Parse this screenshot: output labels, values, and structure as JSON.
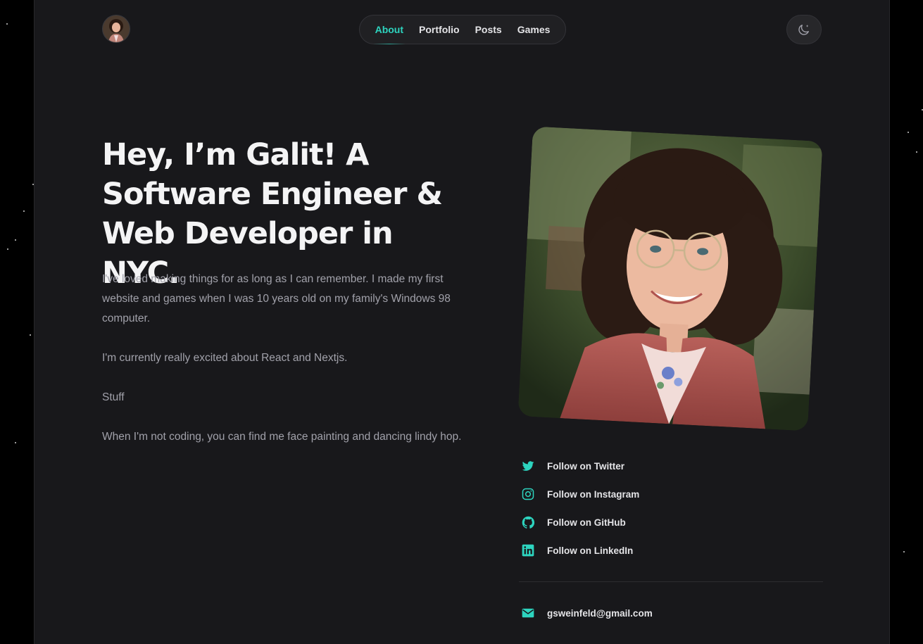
{
  "nav": {
    "items": [
      {
        "label": "About",
        "active": true
      },
      {
        "label": "Portfolio",
        "active": false
      },
      {
        "label": "Posts",
        "active": false
      },
      {
        "label": "Games",
        "active": false
      }
    ]
  },
  "header": {
    "avatar_icon": "profile-avatar",
    "theme_toggle_icon": "moon-icon"
  },
  "hero": {
    "title": "Hey, I’m Galit! A Software Engineer & Web Developer in NYC."
  },
  "bio": {
    "paragraphs": [
      "I've loved making things for as long as I can remember. I made my first website and games when I was 10 years old on my family's Windows 98 computer.",
      "I'm currently really excited about React and Nextjs.",
      "Stuff",
      "When I'm not coding, you can find me face painting and dancing lindy hop."
    ]
  },
  "social": [
    {
      "label": "Follow on Twitter",
      "icon": "twitter-icon"
    },
    {
      "label": "Follow on Instagram",
      "icon": "instagram-icon"
    },
    {
      "label": "Follow on GitHub",
      "icon": "github-icon"
    },
    {
      "label": "Follow on LinkedIn",
      "icon": "linkedin-icon"
    }
  ],
  "contact": {
    "email": "gsweinfeld@gmail.com",
    "icon": "mail-icon"
  },
  "colors": {
    "accent": "#2dd4bf",
    "background": "#18181b",
    "outer": "#000000",
    "heading": "#f4f4f5",
    "body_text": "#a1a1aa"
  }
}
